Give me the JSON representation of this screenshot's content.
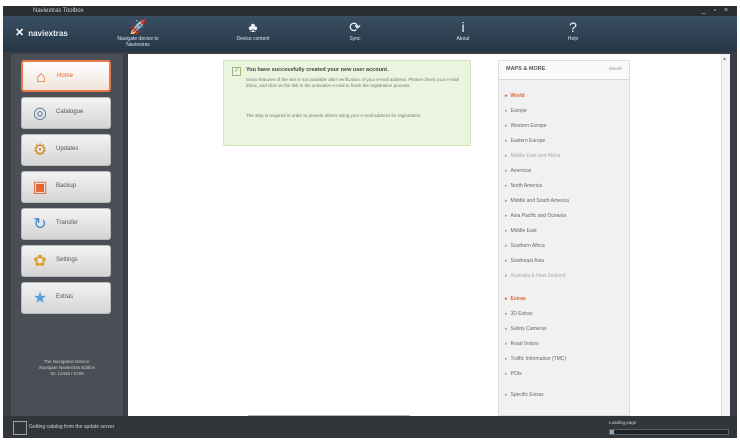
{
  "window": {
    "title": "Naviextras Toolbox",
    "controls": "_ ▫ ×"
  },
  "brand": {
    "name": "naviextras"
  },
  "toolbar": [
    {
      "icon": "rocket-icon",
      "glyph": "🚀",
      "label": "Navigate device to Naviextras"
    },
    {
      "icon": "tree-icon",
      "glyph": "♣",
      "label": "Device content"
    },
    {
      "icon": "refresh-icon",
      "glyph": "⟳",
      "label": "Sync"
    },
    {
      "icon": "info-icon",
      "glyph": "i",
      "label": "About"
    },
    {
      "icon": "help-icon",
      "glyph": "?",
      "label": "Help"
    }
  ],
  "sidebar": {
    "items": [
      {
        "id": "home",
        "label": "Home",
        "glyph": "⌂",
        "icon": "home-icon",
        "active": true
      },
      {
        "id": "catalogue",
        "label": "Catalogue",
        "glyph": "◎",
        "icon": "catalogue-icon"
      },
      {
        "id": "updates",
        "label": "Updates",
        "glyph": "⚙",
        "icon": "updates-icon"
      },
      {
        "id": "backup",
        "label": "Backup",
        "glyph": "▣",
        "icon": "backup-icon"
      },
      {
        "id": "transfer",
        "label": "Transfer",
        "glyph": "↻",
        "icon": "transfer-icon"
      },
      {
        "id": "settings",
        "label": "Settings",
        "glyph": "✿",
        "icon": "settings-icon"
      },
      {
        "id": "extras",
        "label": "Extras",
        "glyph": "★",
        "icon": "extras-icon"
      }
    ],
    "info": [
      "The Navigation Device:",
      "iNavigate Naviextras Edition",
      "ID: 12345 / 6789"
    ]
  },
  "notice": {
    "title": "You have successfully created your new user account.",
    "p1": "Some features of the site is not available after verification of your e-mail address. Please check your e-mail inbox, and click on the link in the activation e-mail to finish the registration process.",
    "p2": "The step is required in order to prevent others using your e-mail address for registration."
  },
  "panel": {
    "title": "MAPS & MORE",
    "action": "details",
    "regions": [
      {
        "label": "World",
        "style": "hl"
      },
      {
        "label": "Europe"
      },
      {
        "label": "Western Europe"
      },
      {
        "label": "Eastern Europe"
      },
      {
        "label": "Middle East and Africa",
        "style": "dim"
      },
      {
        "label": "Americas"
      },
      {
        "label": "North America"
      },
      {
        "label": "Middle and South America"
      },
      {
        "label": "Asia Pacific and Oceania"
      },
      {
        "label": "Middle East"
      },
      {
        "label": "Southern Africa"
      },
      {
        "label": "Southeast Asia"
      },
      {
        "label": "Australia & New Zealand",
        "style": "dim"
      }
    ],
    "extras": [
      {
        "label": "Extras",
        "style": "hl"
      },
      {
        "label": "3D Extras"
      },
      {
        "label": "Safety Cameras"
      },
      {
        "label": "Road Voices"
      },
      {
        "label": "Traffic Information (TMC)"
      },
      {
        "label": "POIs"
      },
      {
        "label": "Specific Extras"
      }
    ]
  },
  "status": {
    "message": "Getting catalog from the update server",
    "loading": "Loading page",
    "progress": 0.03
  }
}
